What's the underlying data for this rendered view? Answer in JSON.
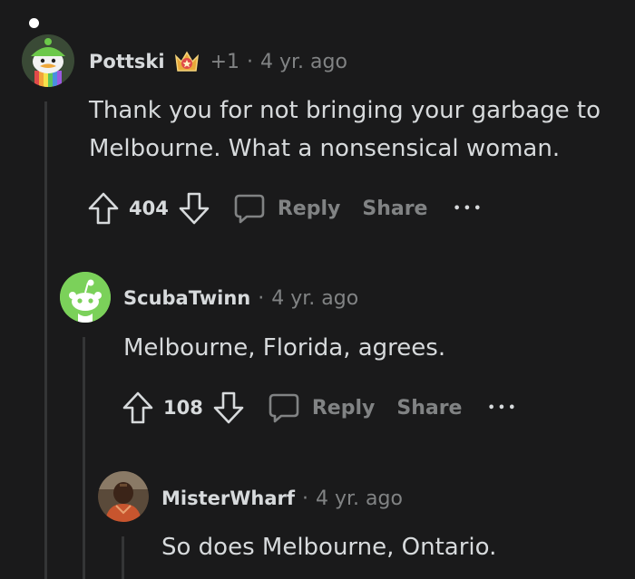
{
  "comments": [
    {
      "username": "Pottski",
      "karma": "+1",
      "separator": "·",
      "age": "4 yr. ago",
      "lines": [
        "Thank you for not bringing your garbage to",
        "Melbourne. What a nonsensical woman."
      ],
      "votes": "404",
      "reply_label": "Reply",
      "share_label": "Share",
      "more_label": "•••"
    },
    {
      "username": "ScubaTwinn",
      "separator": "·",
      "age": "4 yr. ago",
      "lines": [
        "Melbourne, Florida, agrees."
      ],
      "votes": "108",
      "reply_label": "Reply",
      "share_label": "Share",
      "more_label": "•••"
    },
    {
      "username": "MisterWharf",
      "separator": "·",
      "age": "4 yr. ago",
      "lines": [
        "So does Melbourne, Ontario."
      ]
    }
  ],
  "colors": {
    "background": "#1a1a1b",
    "text": "#d7dadc",
    "muted": "#818384",
    "thread_line": "#343536",
    "avatar_green": "#7bd15a"
  },
  "icons": [
    "upvote-icon",
    "downvote-icon",
    "comment-bubble-icon",
    "more-options-icon",
    "award-badge-icon"
  ]
}
